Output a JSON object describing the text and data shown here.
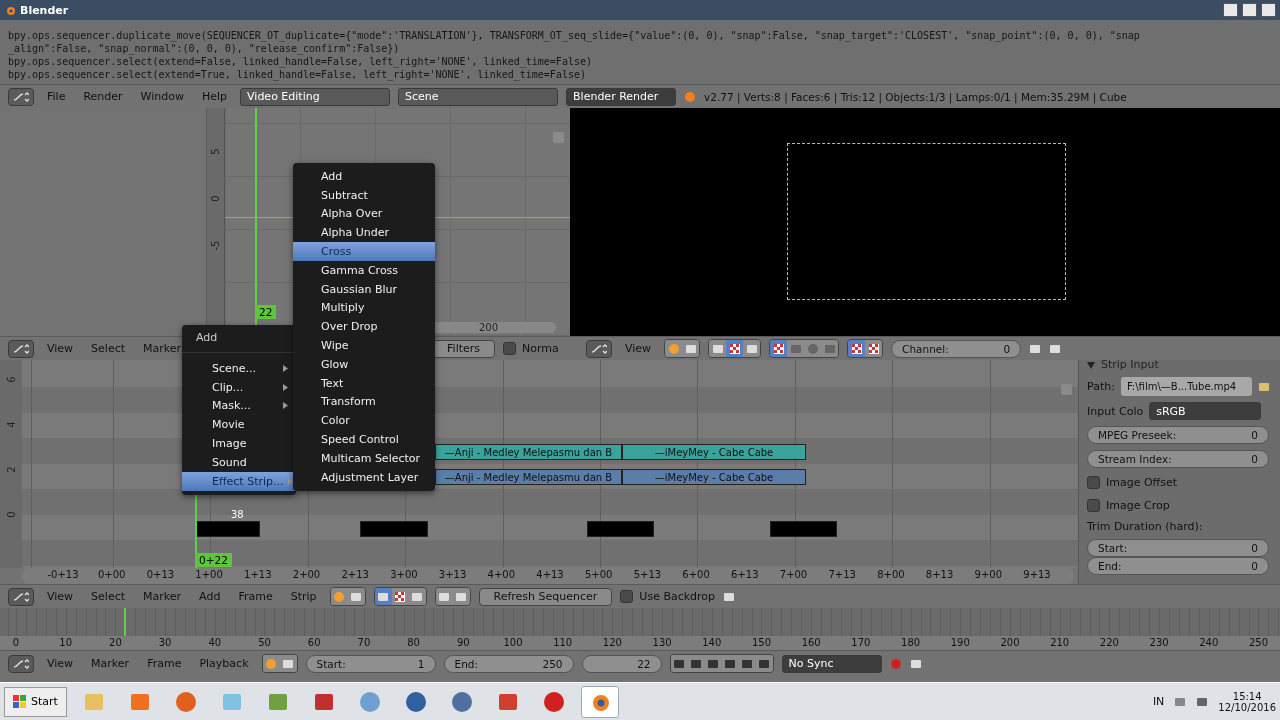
{
  "window": {
    "title": "Blender"
  },
  "console": {
    "lines": [
      "bpy.ops.sequencer.duplicate_move(SEQUENCER_OT_duplicate={\"mode\":'TRANSLATION'}, TRANSFORM_OT_seq_slide={\"value\":(0, 0), \"snap\":False, \"snap_target\":'CLOSEST', \"snap_point\":(0, 0, 0), \"snap",
      "_align\":False, \"snap_normal\":(0, 0, 0), \"release_confirm\":False})",
      "bpy.ops.sequencer.select(extend=False, linked_handle=False, left_right='NONE', linked_time=False)",
      "bpy.ops.sequencer.select(extend=True, linked_handle=False, left_right='NONE', linked_time=False)"
    ]
  },
  "info_header": {
    "menus": [
      "File",
      "Render",
      "Window",
      "Help"
    ],
    "screen_layout": "Video Editing",
    "scene": "Scene",
    "render_engine": "Blender Render",
    "stats": "v2.77 | Verts:8 | Faces:6 | Tris:12 | Objects:1/3 | Lamps:0/1 | Mem:35.29M | Cube"
  },
  "graph_editor": {
    "y_labels": [
      "5",
      "0",
      "-5"
    ],
    "current_frame": "22",
    "scroll_label": "200"
  },
  "graph_header": {
    "menus": [
      "View",
      "Select",
      "Marker"
    ],
    "filters": "Filters",
    "normalize": {
      "label": "Norma",
      "checked": false
    }
  },
  "preview_header": {
    "menus": [
      "View"
    ],
    "channel": {
      "label": "Channel:",
      "value": "0"
    }
  },
  "sequencer": {
    "channel_labels": [
      "6",
      "4",
      "2",
      "0"
    ],
    "strips": [
      {
        "label": "—Anji - Medley Melepasmu dan B",
        "color": "#3aa39b"
      },
      {
        "label": "—iMeyMey - Cabe Cabe",
        "color": "#3aa39b"
      },
      {
        "label": "—Anji - Medley Melepasmu dan B",
        "color": "#5a7ea8"
      },
      {
        "label": "—iMeyMey - Cabe Cabe",
        "color": "#5a7ea8"
      },
      {
        "color": "#000000"
      },
      {
        "color": "#000000"
      },
      {
        "color": "#000000"
      },
      {
        "color": "#000000"
      }
    ],
    "strip_length": "38",
    "current_frame": "0+22",
    "ruler": [
      "-0+13",
      "0+00",
      "0+13",
      "1+00",
      "1+13",
      "2+00",
      "2+13",
      "3+00",
      "3+13",
      "4+00",
      "4+13",
      "5+00",
      "5+13",
      "6+00",
      "6+13",
      "7+00",
      "7+13",
      "8+00",
      "8+13",
      "9+00",
      "9+13"
    ]
  },
  "properties": {
    "panel_title": "Strip Input",
    "path": {
      "label": "Path:",
      "value": "F:\\film\\—B...Tube.mp4"
    },
    "input_color": {
      "label": "Input Colo",
      "value": "sRGB"
    },
    "number_fields": [
      {
        "label": "MPEG Preseek:",
        "value": "0"
      },
      {
        "label": "Stream Index:",
        "value": "0"
      }
    ],
    "checkboxes": [
      {
        "label": "Image Offset",
        "checked": false
      },
      {
        "label": "Image Crop",
        "checked": false
      }
    ],
    "trim_title": "Trim Duration (hard):",
    "trim_fields": [
      {
        "label": "Start:",
        "value": "0"
      },
      {
        "label": "End:",
        "value": "0"
      }
    ]
  },
  "sequencer_header": {
    "menus": [
      "View",
      "Select",
      "Marker",
      "Add",
      "Frame",
      "Strip"
    ],
    "refresh": "Refresh Sequencer",
    "use_backdrop": {
      "label": "Use Backdrop",
      "checked": false
    }
  },
  "timeline": {
    "ruler": [
      "0",
      "10",
      "20",
      "30",
      "40",
      "50",
      "60",
      "70",
      "80",
      "90",
      "100",
      "110",
      "120",
      "130",
      "140",
      "150",
      "160",
      "170",
      "180",
      "190",
      "200",
      "210",
      "220",
      "230",
      "240",
      "250"
    ]
  },
  "timeline_header": {
    "menus": [
      "View",
      "Marker",
      "Frame",
      "Playback"
    ],
    "start": {
      "label": "Start:",
      "value": "1"
    },
    "end": {
      "label": "End:",
      "value": "250"
    },
    "current_frame": "22",
    "sync": "No Sync"
  },
  "add_menu": {
    "title": "Add",
    "items": [
      {
        "label": "Scene...",
        "submenu": true,
        "selected": false
      },
      {
        "label": "Clip...",
        "submenu": true,
        "selected": false
      },
      {
        "label": "Mask...",
        "submenu": true,
        "selected": false
      },
      {
        "label": "Movie",
        "submenu": false,
        "selected": false
      },
      {
        "label": "Image",
        "submenu": false,
        "selected": false
      },
      {
        "label": "Sound",
        "submenu": false,
        "selected": false
      },
      {
        "label": "Effect Strip...",
        "submenu": true,
        "selected": true
      }
    ]
  },
  "effect_menu": {
    "items": [
      {
        "label": "Add",
        "selected": false
      },
      {
        "label": "Subtract",
        "selected": false
      },
      {
        "label": "Alpha Over",
        "selected": false
      },
      {
        "label": "Alpha Under",
        "selected": false
      },
      {
        "label": "Cross",
        "selected": true
      },
      {
        "label": "Gamma Cross",
        "selected": false
      },
      {
        "label": "Gaussian Blur",
        "selected": false
      },
      {
        "label": "Multiply",
        "selected": false
      },
      {
        "label": "Over Drop",
        "selected": false
      },
      {
        "label": "Wipe",
        "selected": false
      },
      {
        "label": "Glow",
        "selected": false
      },
      {
        "label": "Text",
        "selected": false
      },
      {
        "label": "Transform",
        "selected": false
      },
      {
        "label": "Color",
        "selected": false
      },
      {
        "label": "Speed Control",
        "selected": false
      },
      {
        "label": "Multicam Selector",
        "selected": false
      },
      {
        "label": "Adjustment Layer",
        "selected": false
      }
    ]
  },
  "taskbar": {
    "start": "Start",
    "language": "IN",
    "time": "15:14",
    "date": "12/10/2016"
  }
}
